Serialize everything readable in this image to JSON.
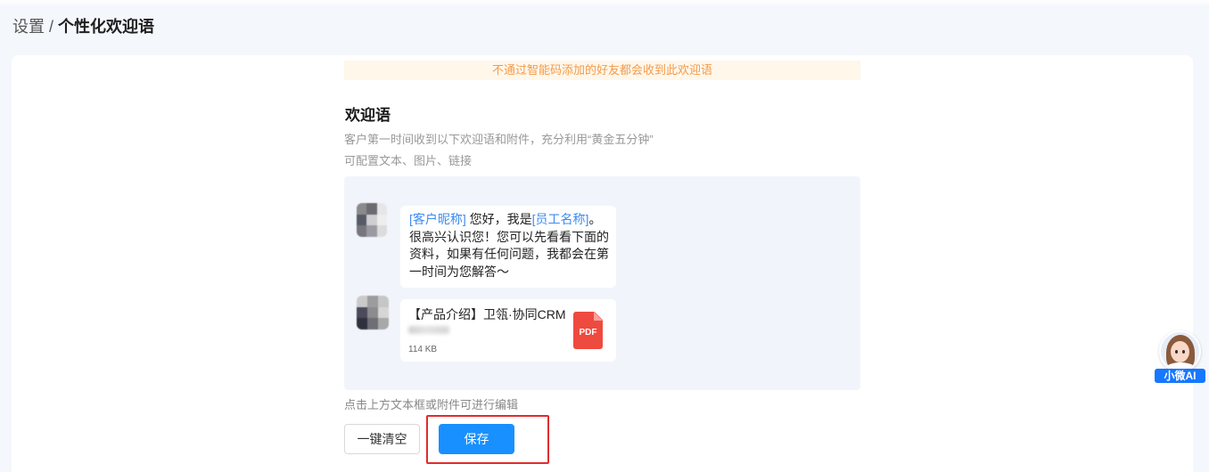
{
  "breadcrumb": {
    "parent": "设置",
    "separator": "/",
    "current": "个性化欢迎语"
  },
  "notice": "不通过智能码添加的好友都会收到此欢迎语",
  "welcome": {
    "title": "欢迎语",
    "description": "客户第一时间收到以下欢迎语和附件，充分利用“黄金五分钟”",
    "config_hint": "可配置文本、图片、链接"
  },
  "preview": {
    "message": {
      "customer_variable": "[客户昵称]",
      "greeting": " 您好，我是",
      "staff_variable": "[员工名称]",
      "body": "。很高兴认识您！您可以先看看下面的资料，如果有任何问题，我都会在第一时间为您解答～"
    },
    "attachment": {
      "title": "【产品介绍】卫瓴·协同CRM",
      "size": "114 KB",
      "file_type": "PDF",
      "icon": "pdf-file-icon"
    }
  },
  "edit_hint": "点击上方文本框或附件可进行编辑",
  "actions": {
    "clear_label": "一键清空",
    "save_label": "保存"
  },
  "assistant": {
    "label": "小微AI",
    "icon": "assistant-avatar-icon"
  },
  "colors": {
    "accent": "#1890ff",
    "variable": "#3d8bf0",
    "notice_text": "#f39b4b",
    "notice_bg": "#fff7ea",
    "annotation": "#e32b2b",
    "pdf": "#ef4a3f",
    "preview_bg": "#f1f5fb",
    "page_bg": "#f4f7fb"
  }
}
